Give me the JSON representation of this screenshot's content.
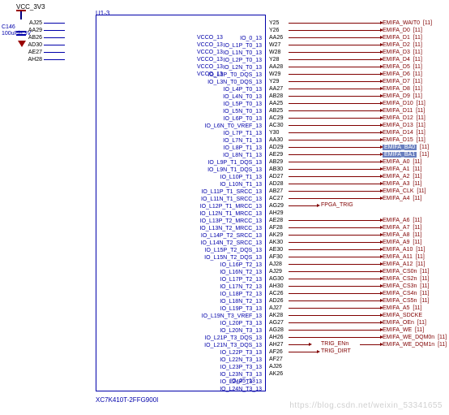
{
  "power": {
    "vcc_label": "VCC_3V3",
    "cap_ref": "C146",
    "cap_val": "100uF/6.3V"
  },
  "ic": {
    "ref": "U1-3",
    "part": "XC7K410T-2FFG900I",
    "last_io": "IO_25_13"
  },
  "vcco_pins": [
    {
      "pin": "AJ25",
      "name": "VCCO_13"
    },
    {
      "pin": "AA29",
      "name": "VCCO_13"
    },
    {
      "pin": "AB26",
      "name": "VCCO_13"
    },
    {
      "pin": "AD30",
      "name": "VCCO_13"
    },
    {
      "pin": "AE27",
      "name": "VCCO_13"
    },
    {
      "pin": "AH28",
      "name": "VCCO_13"
    }
  ],
  "rows": [
    {
      "io": "IO_0_13",
      "pin": "Y25",
      "net": "EMIFA_WAIT0",
      "pg": "[11]"
    },
    {
      "io": "IO_L1P_T0_13",
      "pin": "Y26",
      "net": "EMIFA_D0",
      "pg": "[11]"
    },
    {
      "io": "IO_L1N_T0_13",
      "pin": "AA26",
      "net": "EMIFA_D1",
      "pg": "[11]"
    },
    {
      "io": "IO_L2P_T0_13",
      "pin": "W27",
      "net": "EMIFA_D2",
      "pg": "[11]"
    },
    {
      "io": "IO_L2N_T0_13",
      "pin": "W28",
      "net": "EMIFA_D3",
      "pg": "[11]"
    },
    {
      "io": "IO_L3P_T0_DQS_13",
      "pin": "Y28",
      "net": "EMIFA_D4",
      "pg": "[11]"
    },
    {
      "io": "IO_L3N_T0_DQS_13",
      "pin": "AA28",
      "net": "EMIFA_D5",
      "pg": "[11]"
    },
    {
      "io": "IO_L4P_T0_13",
      "pin": "W29",
      "net": "EMIFA_D6",
      "pg": "[11]"
    },
    {
      "io": "IO_L4N_T0_13",
      "pin": "Y29",
      "net": "EMIFA_D7",
      "pg": "[11]"
    },
    {
      "io": "IO_L5P_T0_13",
      "pin": "AA27",
      "net": "EMIFA_D8",
      "pg": "[11]"
    },
    {
      "io": "IO_L5N_T0_13",
      "pin": "AB28",
      "net": "EMIFA_D9",
      "pg": "[11]"
    },
    {
      "io": "IO_L6P_T0_13",
      "pin": "AA25",
      "net": "EMIFA_D10",
      "pg": "[11]"
    },
    {
      "io": "IO_L6N_T0_VREF_13",
      "pin": "AB25",
      "net": "EMIFA_D11",
      "pg": "[11]"
    },
    {
      "io": "IO_L7P_T1_13",
      "pin": "AC29",
      "net": "EMIFA_D12",
      "pg": "[11]"
    },
    {
      "io": "IO_L7N_T1_13",
      "pin": "AC30",
      "net": "EMIFA_D13",
      "pg": "[11]"
    },
    {
      "io": "IO_L8P_T1_13",
      "pin": "Y30",
      "net": "EMIFA_D14",
      "pg": "[11]"
    },
    {
      "io": "IO_L8N_T1_13",
      "pin": "AA30",
      "net": "EMIFA_D15",
      "pg": "[11]"
    },
    {
      "io": "IO_L9P_T1_DQS_13",
      "pin": "AD29",
      "net": "EMIFA_BA0",
      "pg": "[11]",
      "hl": true
    },
    {
      "io": "IO_L9N_T1_DQS_13",
      "pin": "AE29",
      "net": "EMIFA_BA1",
      "pg": "[11]",
      "hl": true
    },
    {
      "io": "IO_L10P_T1_13",
      "pin": "AB29",
      "net": "EMIFA_A0",
      "pg": "[11]"
    },
    {
      "io": "IO_L10N_T1_13",
      "pin": "AB30",
      "net": "EMIFA_A1",
      "pg": "[11]"
    },
    {
      "io": "IO_L11P_T1_SRCC_13",
      "pin": "AD27",
      "net": "EMIFA_A2",
      "pg": "[11]"
    },
    {
      "io": "IO_L11N_T1_SRCC_13",
      "pin": "AD28",
      "net": "EMIFA_A3",
      "pg": "[11]"
    },
    {
      "io": "IO_L12P_T1_MRCC_13",
      "pin": "AB27",
      "net": "EMIFA_CLK",
      "pg": "[11]"
    },
    {
      "io": "IO_L12N_T1_MRCC_13",
      "pin": "AC27",
      "net": "EMIFA_A4",
      "pg": "[11]"
    },
    {
      "io": "IO_L13P_T2_MRCC_13",
      "pin": "AG29",
      "net": "FPGA_TRIG",
      "pg": "",
      "short": true
    },
    {
      "io": "IO_L13N_T2_MRCC_13",
      "pin": "AH29",
      "net": "",
      "pg": ""
    },
    {
      "io": "IO_L14P_T2_SRCC_13",
      "pin": "AE28",
      "net": "EMIFA_A6",
      "pg": "[11]"
    },
    {
      "io": "IO_L14N_T2_SRCC_13",
      "pin": "AF28",
      "net": "EMIFA_A7",
      "pg": "[11]"
    },
    {
      "io": "IO_L15P_T2_DQS_13",
      "pin": "AK29",
      "net": "EMIFA_A8",
      "pg": "[11]"
    },
    {
      "io": "IO_L15N_T2_DQS_13",
      "pin": "AK30",
      "net": "EMIFA_A9",
      "pg": "[11]"
    },
    {
      "io": "IO_L16P_T2_13",
      "pin": "AE30",
      "net": "EMIFA_A10",
      "pg": "[11]"
    },
    {
      "io": "IO_L16N_T2_13",
      "pin": "AF30",
      "net": "EMIFA_A11",
      "pg": "[11]"
    },
    {
      "io": "IO_L17P_T2_13",
      "pin": "AJ28",
      "net": "EMIFA_A12",
      "pg": "[11]"
    },
    {
      "io": "IO_L17N_T2_13",
      "pin": "AJ29",
      "net": "EMIFA_CS0n",
      "pg": "[11]"
    },
    {
      "io": "IO_L18P_T2_13",
      "pin": "AG30",
      "net": "EMIFA_CS2n",
      "pg": "[11]"
    },
    {
      "io": "IO_L18N_T2_13",
      "pin": "AH30",
      "net": "EMIFA_CS3n",
      "pg": "[11]"
    },
    {
      "io": "IO_L19P_T3_13",
      "pin": "AC26",
      "net": "EMIFA_CS4n",
      "pg": "[11]"
    },
    {
      "io": "IO_L19N_T3_VREF_13",
      "pin": "AD26",
      "net": "EMIFA_CS5n",
      "pg": "[11]"
    },
    {
      "io": "IO_L20P_T3_13",
      "pin": "AJ27",
      "net": "EMIFA_A5",
      "pg": "[11]"
    },
    {
      "io": "IO_L20N_T3_13",
      "pin": "AK28",
      "net": "EMIFA_SDCKE",
      "pg": ""
    },
    {
      "io": "IO_L21P_T3_DQS_13",
      "pin": "AG27",
      "net": "EMIFA_OEn",
      "pg": "[11]"
    },
    {
      "io": "IO_L21N_T3_DQS_13",
      "pin": "AG28",
      "net": "EMIFA_WE",
      "pg": "[11]"
    },
    {
      "io": "IO_L22P_T3_13",
      "pin": "AH26",
      "net": "EMIFA_WE_DQM0n",
      "pg": "[11]"
    },
    {
      "io": "IO_L22N_T3_13",
      "pin": "AH27",
      "net": "TRIG_ENn",
      "pg": "",
      "short": true,
      "ext": "EMIFA_WE_DQM1n",
      "extpg": "[11]"
    },
    {
      "io": "IO_L23P_T3_13",
      "pin": "AF26",
      "net": "TRIG_DIRT",
      "pg": "",
      "short": true
    },
    {
      "io": "IO_L23N_T3_13",
      "pin": "AF27",
      "net": "",
      "pg": ""
    },
    {
      "io": "IO_L24P_T3_13",
      "pin": "AJ26",
      "net": "",
      "pg": ""
    },
    {
      "io": "IO_L24N_T3_13",
      "pin": "AK26",
      "net": "",
      "pg": ""
    }
  ],
  "watermark": "https://blog.csdn.net/weixin_53341655"
}
